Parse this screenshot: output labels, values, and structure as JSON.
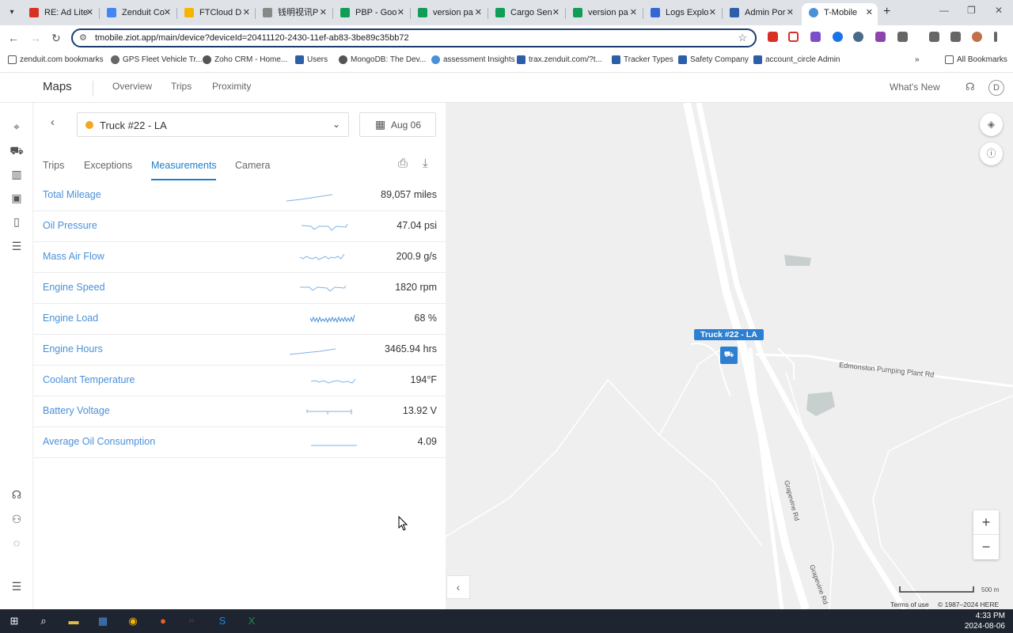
{
  "browser": {
    "tabs": [
      {
        "label": "RE: Ad Lite",
        "color": "#d93025"
      },
      {
        "label": "Zenduit Co",
        "color": "#4285f4"
      },
      {
        "label": "FTCloud D",
        "color": "#f4b400"
      },
      {
        "label": "钱明视讯P",
        "color": "#888888"
      },
      {
        "label": "PBP - Goo",
        "color": "#0f9d58"
      },
      {
        "label": "version pa",
        "color": "#0f9d58"
      },
      {
        "label": "Cargo Sen",
        "color": "#0f9d58"
      },
      {
        "label": "version pa",
        "color": "#0f9d58"
      },
      {
        "label": "Logs Explo",
        "color": "#3367d6"
      },
      {
        "label": "Admin Por",
        "color": "#2c5fa8"
      },
      {
        "label": "T-Mobile",
        "color": "#4a90d9"
      }
    ],
    "url": "tmobile.ziot.app/main/device?deviceId=20411120-2430-11ef-ab83-3be89c35bb72",
    "bookmarks": [
      {
        "label": "zenduit.com bookmarks"
      },
      {
        "label": "GPS Fleet Vehicle Tr..."
      },
      {
        "label": "Zoho CRM - Home..."
      },
      {
        "label": "Users"
      },
      {
        "label": "MongoDB: The Dev..."
      },
      {
        "label": "assessment Insights"
      },
      {
        "label": "trax.zenduit.com/?t..."
      },
      {
        "label": "Tracker Types"
      },
      {
        "label": "Safety Company"
      },
      {
        "label": "account_circle Admin"
      }
    ],
    "all_bookmarks": "All Bookmarks"
  },
  "app": {
    "title": "Maps",
    "nav": [
      "Overview",
      "Trips",
      "Proximity"
    ],
    "whats_new": "What's New",
    "avatar": "D"
  },
  "panel": {
    "device": "Truck #22 - LA",
    "date": "Aug 06",
    "tabs": [
      "Trips",
      "Exceptions",
      "Measurements",
      "Camera"
    ],
    "active_tab": "Measurements",
    "measurements": [
      {
        "name": "Total Mileage",
        "value": "89,057 miles"
      },
      {
        "name": "Oil Pressure",
        "value": "47.04 psi"
      },
      {
        "name": "Mass Air Flow",
        "value": "200.9 g/s"
      },
      {
        "name": "Engine Speed",
        "value": "1820 rpm"
      },
      {
        "name": "Engine Load",
        "value": "68 %"
      },
      {
        "name": "Engine Hours",
        "value": "3465.94 hrs"
      },
      {
        "name": "Coolant Temperature",
        "value": "194°F"
      },
      {
        "name": "Battery Voltage",
        "value": "13.92 V"
      },
      {
        "name": "Average Oil Consumption",
        "value": "4.09"
      }
    ]
  },
  "map": {
    "marker_label": "Truck #22 - LA",
    "road_edmonston": "Edmonston Pumping Plant Rd",
    "road_grapevine": "Grapevine Rd",
    "road_grapevine2": "Grapevine Rd",
    "terms": "Terms of use",
    "copyright": "© 1987–2024 HERE",
    "scale": "500 m"
  },
  "taskbar": {
    "time": "4:33 PM",
    "date": "2024-08-06"
  },
  "colors": {
    "accent": "#1e7fc6",
    "link": "#4a90d9",
    "status_dot": "#f5a623",
    "marker": "#2c7fd1"
  }
}
